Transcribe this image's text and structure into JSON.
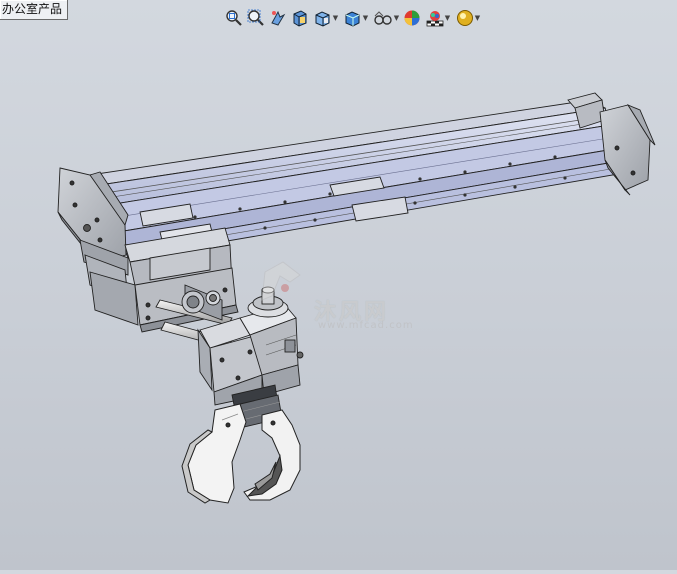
{
  "document_tab": {
    "label": "办公室产品"
  },
  "toolbar": {
    "buttons": [
      {
        "name": "zoom-to-fit",
        "icon": "zoom-fit-icon"
      },
      {
        "name": "zoom-to-area",
        "icon": "zoom-area-icon"
      },
      {
        "name": "previous-view",
        "icon": "previous-view-icon"
      },
      {
        "name": "section-view",
        "icon": "section-view-icon"
      },
      {
        "name": "view-orientation",
        "icon": "view-orientation-icon",
        "dropdown": true
      },
      {
        "name": "display-style",
        "icon": "display-style-icon",
        "dropdown": true
      },
      {
        "name": "hide-show-items",
        "icon": "hide-show-icon",
        "dropdown": true
      },
      {
        "name": "edit-appearance",
        "icon": "appearance-icon"
      },
      {
        "name": "apply-scene",
        "icon": "scene-icon",
        "dropdown": true
      },
      {
        "name": "view-settings",
        "icon": "view-settings-icon",
        "dropdown": true
      }
    ]
  },
  "watermark": {
    "brand_cn": "沐风网",
    "url": "www.mfcad.com"
  },
  "colors": {
    "background_top": "#d3d8df",
    "background_bottom": "#bfc4cc",
    "metal_grey": "#b8bcc4",
    "rail_blue": "#c7cde6",
    "gripper_white": "#f2f2f2",
    "outline": "#222222"
  }
}
